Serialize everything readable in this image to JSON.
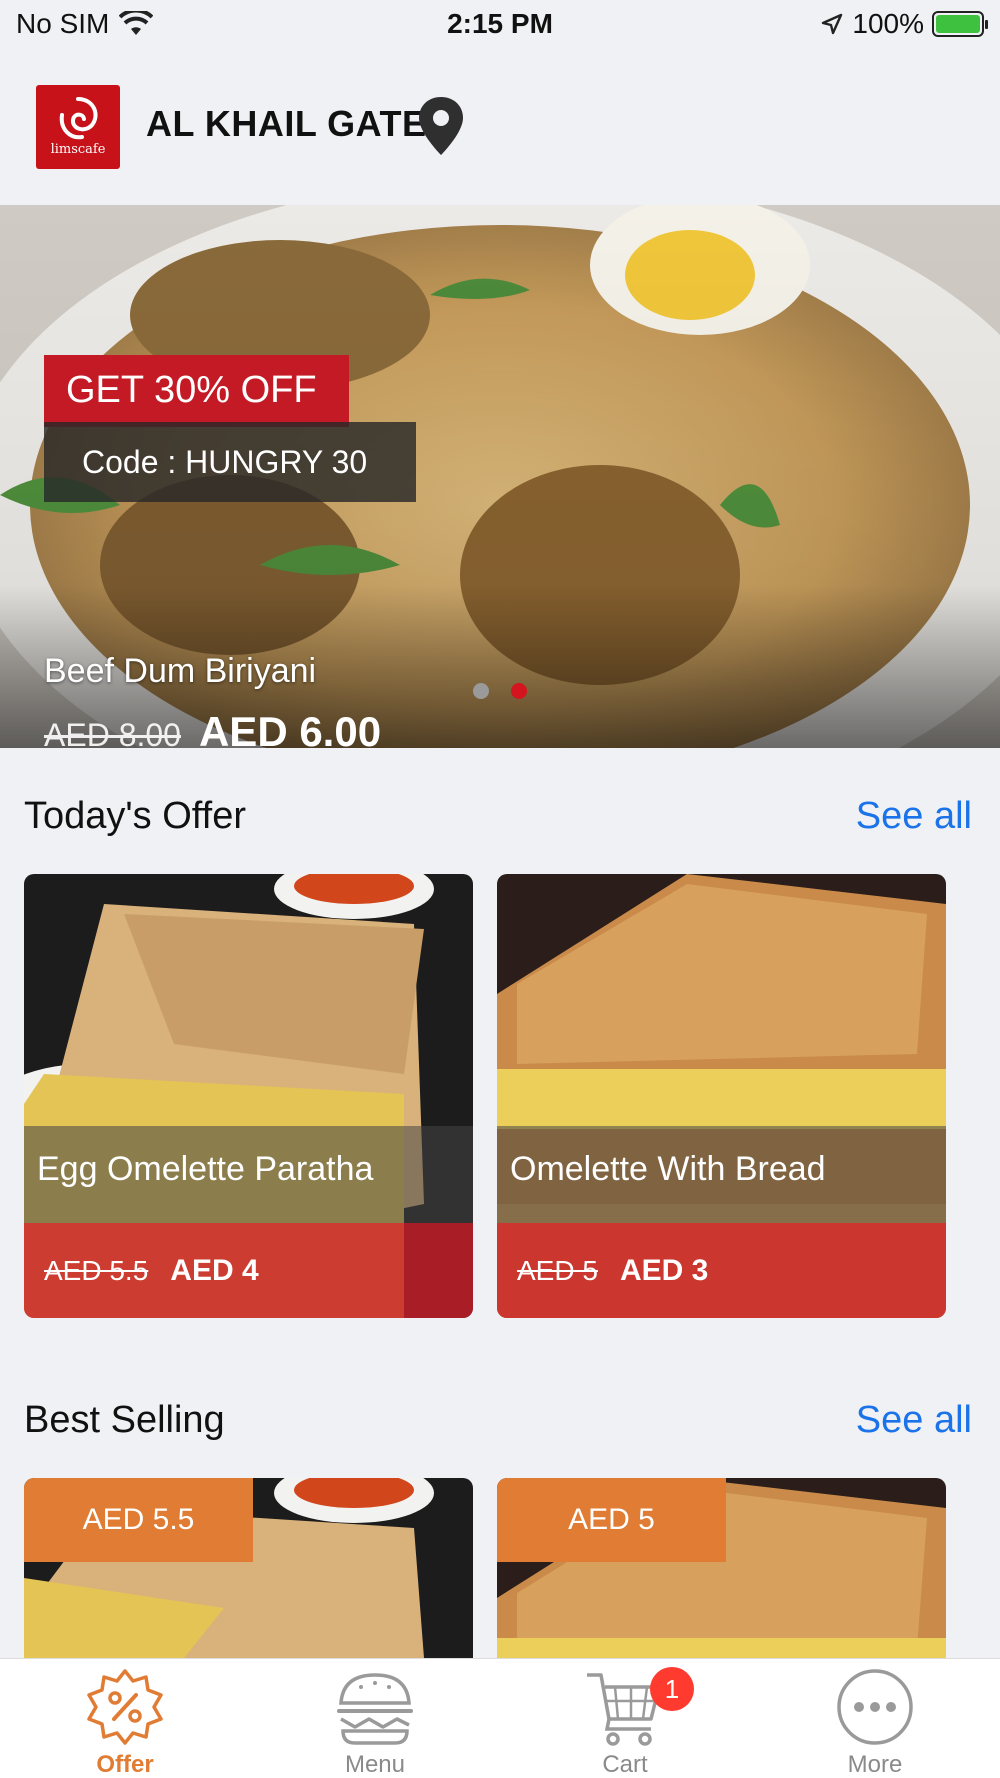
{
  "status_bar": {
    "carrier": "No SIM",
    "time": "2:15 PM",
    "battery": "100%"
  },
  "header": {
    "logo_text": "limscafe",
    "store_name": "AL KHAIL GATE"
  },
  "banner": {
    "promo_line1": "GET 30% OFF",
    "promo_line2": "Code : HUNGRY 30",
    "title": "Beef Dum Biriyani",
    "old_price": "AED 8.00",
    "new_price": "AED 6.00",
    "slide_count": 2,
    "active_slide": 2
  },
  "todays_offer": {
    "title": "Today's Offer",
    "see_all": "See all",
    "items": [
      {
        "name": "Egg Omelette Paratha",
        "old_price": "AED 5.5",
        "new_price": "AED 4"
      },
      {
        "name": "Omelette With Bread",
        "old_price": "AED 5",
        "new_price": "AED 3"
      }
    ]
  },
  "best_selling": {
    "title": "Best Selling",
    "see_all": "See all",
    "items": [
      {
        "price": "AED 5.5"
      },
      {
        "price": "AED 5"
      }
    ]
  },
  "tabbar": {
    "tabs": [
      {
        "label": "Offer",
        "icon": "offer-badge-icon",
        "active": true
      },
      {
        "label": "Menu",
        "icon": "burger-icon",
        "active": false
      },
      {
        "label": "Cart",
        "icon": "cart-icon",
        "active": false,
        "badge": "1"
      },
      {
        "label": "More",
        "icon": "more-icon",
        "active": false
      }
    ]
  },
  "colors": {
    "brand_red": "#c8121a",
    "accent_orange": "#e07c33",
    "link_blue": "#1a73e8"
  }
}
